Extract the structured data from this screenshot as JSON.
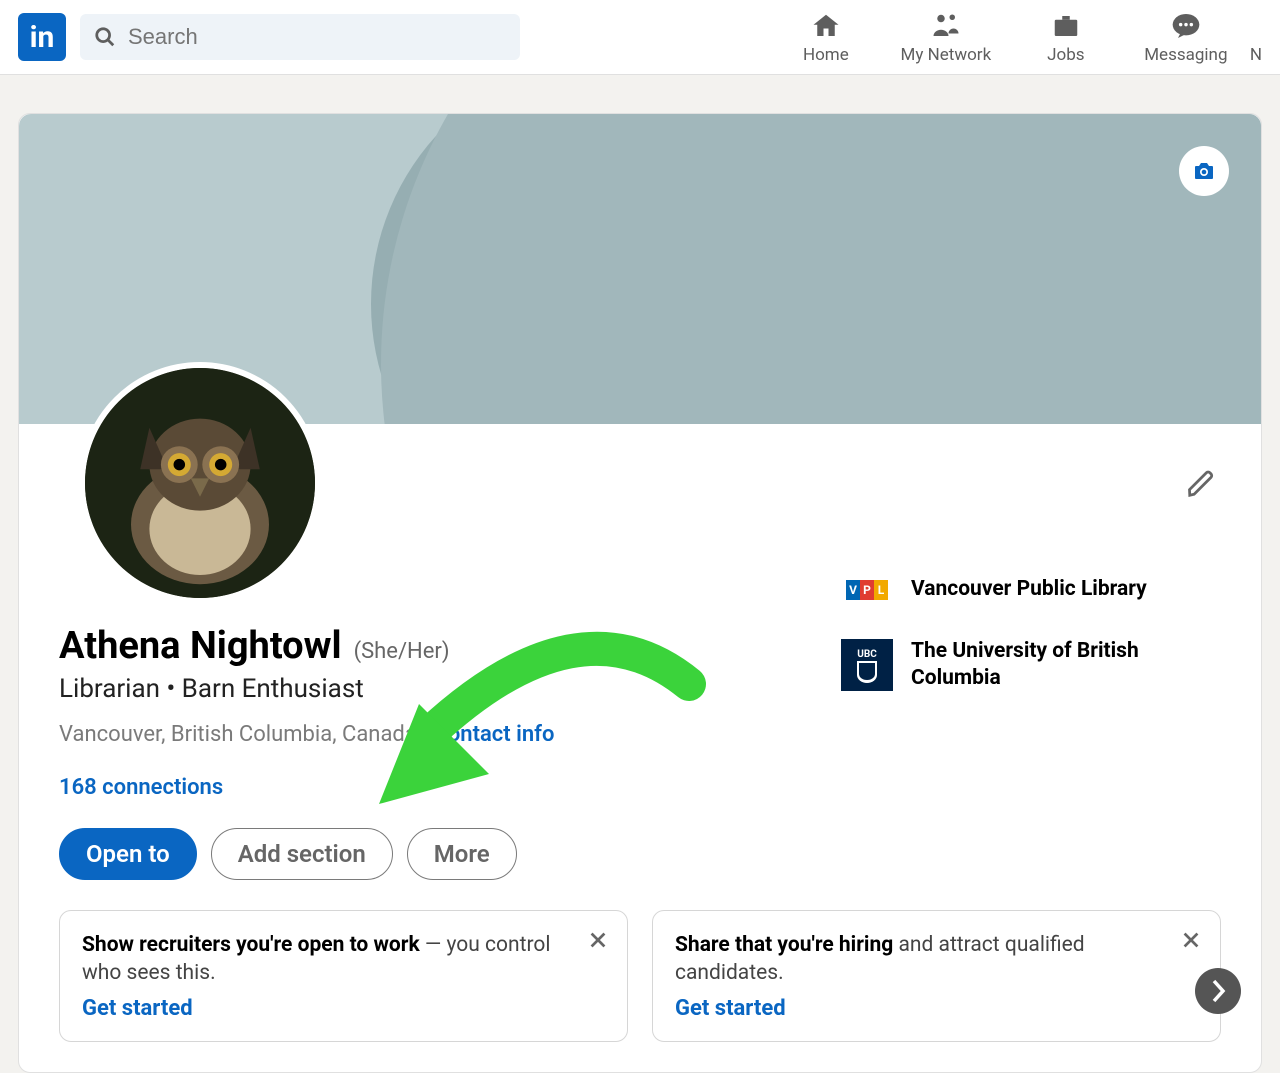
{
  "nav": {
    "search_placeholder": "Search",
    "items": [
      {
        "label": "Home"
      },
      {
        "label": "My Network"
      },
      {
        "label": "Jobs"
      },
      {
        "label": "Messaging"
      }
    ],
    "trailing": "N"
  },
  "profile": {
    "name": "Athena Nightowl",
    "pronouns": "(She/Her)",
    "headline": "Librarian • Barn Enthusiast",
    "location": "Vancouver, British Columbia, Canada",
    "sep": " · ",
    "contact_info": "Contact info",
    "connections": "168 connections",
    "buttons": {
      "open_to": "Open to",
      "add_section": "Add section",
      "more": "More"
    },
    "orgs": [
      {
        "name": "Vancouver Public Library",
        "logo": "vpl"
      },
      {
        "name": "The University of British Columbia",
        "logo": "ubc"
      }
    ]
  },
  "promos": [
    {
      "bold": "Show recruiters you're open to work",
      "rest": " — you control who sees this.",
      "cta": "Get started"
    },
    {
      "bold": "Share that you're hiring",
      "rest": " and attract qualified candidates.",
      "cta": "Get started"
    }
  ]
}
